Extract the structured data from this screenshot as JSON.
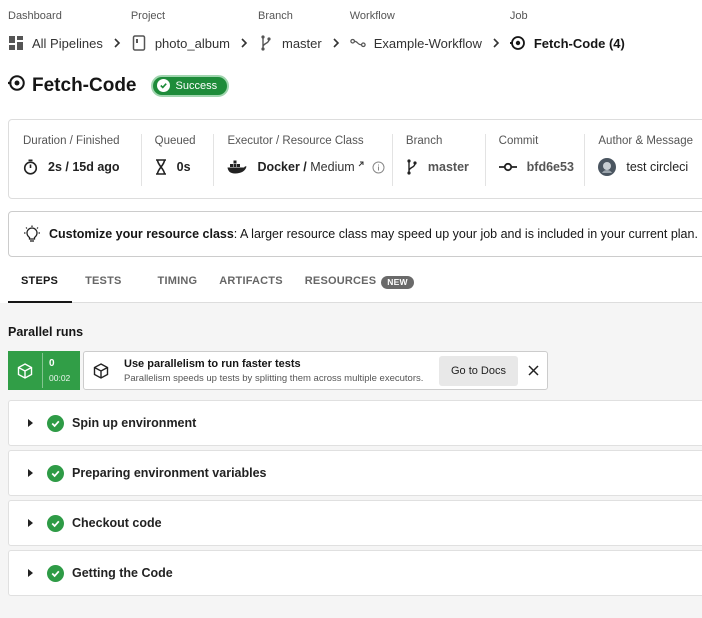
{
  "breadcrumb": [
    {
      "label": "Dashboard",
      "value": "All Pipelines",
      "icon": "pipelines-icon"
    },
    {
      "label": "Project",
      "value": "photo_album",
      "icon": "project-icon"
    },
    {
      "label": "Branch",
      "value": "master",
      "icon": "branch-icon"
    },
    {
      "label": "Workflow",
      "value": "Example-Workflow",
      "icon": "workflow-icon"
    },
    {
      "label": "Job",
      "value": "Fetch-Code (4)",
      "icon": "job-icon"
    }
  ],
  "job": {
    "title": "Fetch-Code",
    "status": "Success",
    "status_color": "#1e8c3a"
  },
  "details": {
    "duration_label": "Duration / Finished",
    "duration_value": "2s / 15d ago",
    "queued_label": "Queued",
    "queued_value": "0s",
    "executor_label": "Executor / Resource Class",
    "executor_value": "Docker",
    "executor_sep": " / ",
    "resource_class": "Medium",
    "branch_label": "Branch",
    "branch_value": "master",
    "commit_label": "Commit",
    "commit_value": "bfd6e53",
    "author_label": "Author & Message",
    "author_value": "test circleci"
  },
  "banner": {
    "bold": "Customize your resource class",
    "text": ": A larger resource class may speed up your job and is included in your current plan."
  },
  "tabs": [
    {
      "label": "STEPS",
      "active": true
    },
    {
      "label": "TESTS"
    },
    {
      "label": "TIMING"
    },
    {
      "label": "ARTIFACTS"
    },
    {
      "label": "RESOURCES",
      "badge": "NEW"
    }
  ],
  "parallel": {
    "title": "Parallel runs",
    "run_index": "0",
    "run_time": "00:02",
    "promo_title": "Use parallelism to run faster tests",
    "promo_text": "Parallelism speeds up tests by splitting them across multiple executors.",
    "docs_button": "Go to Docs"
  },
  "steps": [
    {
      "label": "Spin up environment"
    },
    {
      "label": "Preparing environment variables"
    },
    {
      "label": "Checkout code"
    },
    {
      "label": "Getting the Code"
    }
  ],
  "colors": {
    "success": "#319e47",
    "accent": "#161616"
  }
}
